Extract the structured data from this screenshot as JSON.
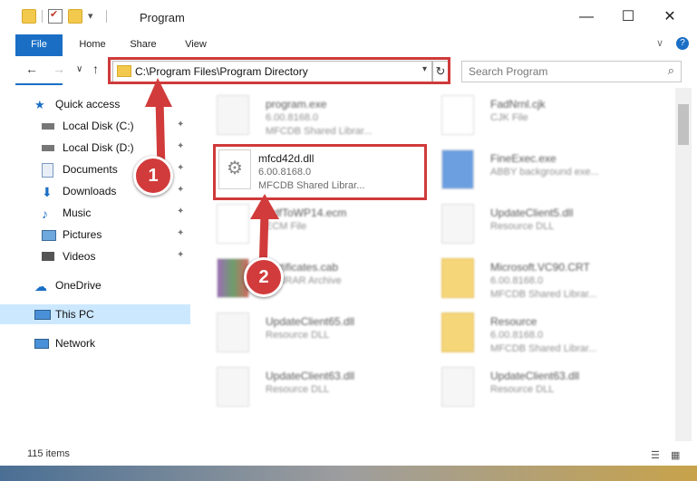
{
  "window": {
    "title": "Program",
    "controls": {
      "minimize": "—",
      "maximize": "☐",
      "close": "✕"
    }
  },
  "ribbon": {
    "tabs": [
      "File",
      "Home",
      "Share",
      "View"
    ],
    "help_chevron": "∨",
    "help_icon": "?"
  },
  "nav": {
    "back": "←",
    "forward": "→",
    "recent": "∨",
    "up": "↑",
    "address": "C:\\Program Files\\Program Directory",
    "refresh": "↻",
    "search_placeholder": "Search Program",
    "search_icon": "⌕"
  },
  "sidebar": {
    "items": [
      {
        "label": "Quick access",
        "icon": "star-icon",
        "pinned": false
      },
      {
        "label": "Local Disk (C:)",
        "icon": "drive-icon",
        "pinned": true
      },
      {
        "label": "Local Disk (D:)",
        "icon": "drive-icon",
        "pinned": true
      },
      {
        "label": "Documents",
        "icon": "documents-icon",
        "pinned": true
      },
      {
        "label": "Downloads",
        "icon": "downloads-icon",
        "pinned": true
      },
      {
        "label": "Music",
        "icon": "music-icon",
        "pinned": true
      },
      {
        "label": "Pictures",
        "icon": "pictures-icon",
        "pinned": true
      },
      {
        "label": "Videos",
        "icon": "videos-icon",
        "pinned": true
      },
      {
        "label": "OneDrive",
        "icon": "onedrive-icon",
        "pinned": false
      },
      {
        "label": "This PC",
        "icon": "computer-icon",
        "pinned": false
      },
      {
        "label": "Network",
        "icon": "network-icon",
        "pinned": false
      }
    ],
    "pin_glyph": "📌"
  },
  "files": [
    {
      "name": "program.exe",
      "line1": "6.00.8168.0",
      "line2": "MFCDB Shared Librar..."
    },
    {
      "name": "FadNrnl.cjk",
      "line1": "CJK File",
      "line2": ""
    },
    {
      "name": "mfcd42d.dll",
      "line1": "6.00.8168.0",
      "line2": "MFCDB Shared Librar..."
    },
    {
      "name": "FineExec.exe",
      "line1": "ABBY background exe...",
      "line2": ""
    },
    {
      "name": "PdfToWP14.ecm",
      "line1": "ECM File",
      "line2": ""
    },
    {
      "name": "UpdateClient5.dll",
      "line1": "Resource DLL",
      "line2": ""
    },
    {
      "name": "certificates.cab",
      "line1": "WINRAR Archive",
      "line2": ""
    },
    {
      "name": "Microsoft.VC90.CRT",
      "line1": "6.00.8168.0",
      "line2": "MFCDB Shared Librar..."
    },
    {
      "name": "UpdateClient65.dll",
      "line1": "Resource DLL",
      "line2": ""
    },
    {
      "name": "Resource",
      "line1": "6.00.8168.0",
      "line2": "MFCDB Shared Librar..."
    },
    {
      "name": "UpdateClient63.dll",
      "line1": "Resource DLL",
      "line2": ""
    },
    {
      "name": "UpdateClient63.dll",
      "line1": "Resource DLL",
      "line2": ""
    }
  ],
  "annotations": {
    "callout_1": "1",
    "callout_2": "2"
  },
  "status": {
    "item_count": "115 items"
  },
  "colors": {
    "accent": "#1a6fc5",
    "highlight": "#cf3a3a",
    "selected": "#cce8ff"
  }
}
